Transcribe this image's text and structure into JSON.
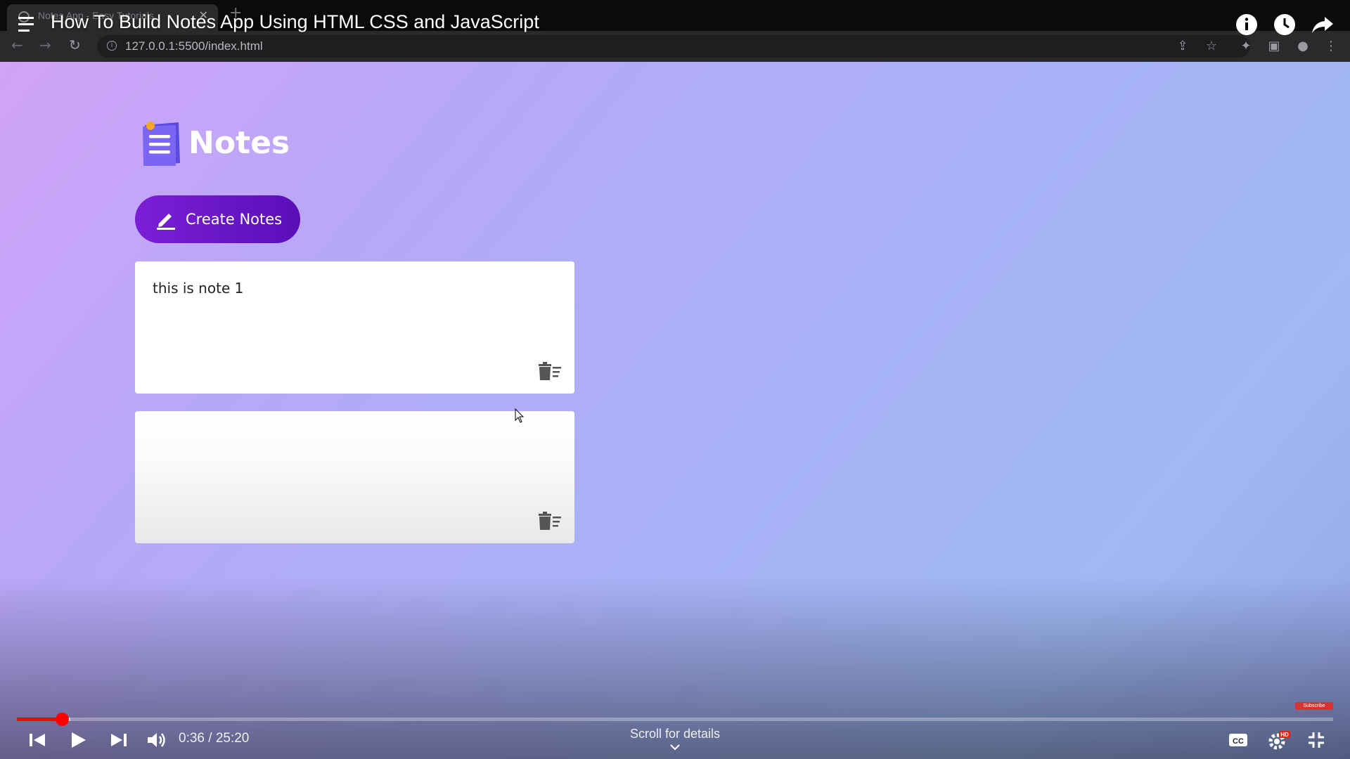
{
  "browser": {
    "tab_title": "Notes App - Easy Tutorials",
    "url": "127.0.0.1:5500/index.html"
  },
  "video": {
    "title": "How To Build Notes App Using HTML CSS and JavaScript",
    "time_display": "0:36 / 25:20",
    "scroll_hint": "Scroll for details",
    "progress_fraction": 0.024,
    "subscribe_badge": "Subscribe"
  },
  "app": {
    "title": "Notes",
    "create_button_label": "Create Notes",
    "notes": [
      {
        "text": "this is note 1"
      },
      {
        "text": ""
      }
    ]
  },
  "colors": {
    "button_start": "#7b1fd6",
    "button_end": "#5a0fb8",
    "progress": "#ff0000"
  },
  "icons": [
    "hamburger-icon",
    "info-icon",
    "watch-later-icon",
    "share-icon",
    "back-icon",
    "forward-icon",
    "reload-icon",
    "site-info-icon",
    "share-page-icon",
    "bookmark-star-icon",
    "extensions-icon",
    "sidebar-icon",
    "profile-icon",
    "more-menu-icon",
    "notes-logo-icon",
    "pencil-icon",
    "trash-icon",
    "cursor-icon",
    "previous-icon",
    "play-icon",
    "next-icon",
    "volume-icon",
    "captions-icon",
    "settings-icon",
    "exit-fullscreen-icon",
    "chevron-down-icon"
  ]
}
